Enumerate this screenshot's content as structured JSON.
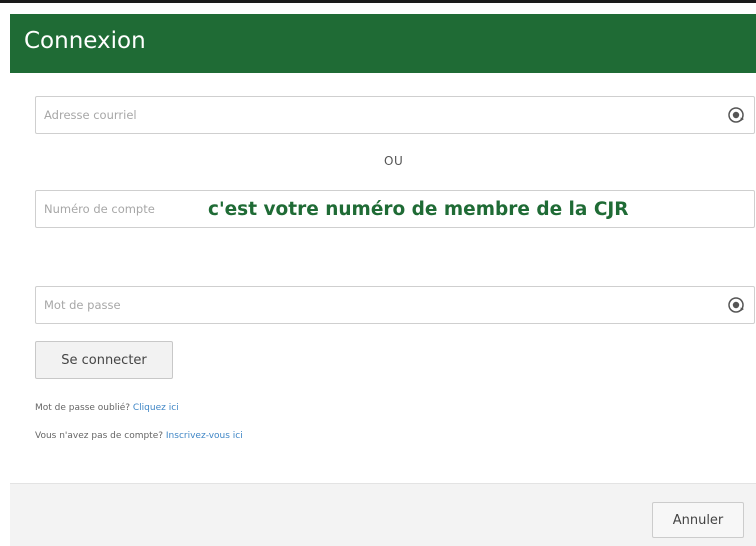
{
  "dialog": {
    "title": "Connexion"
  },
  "form": {
    "email_placeholder": "Adresse courriel",
    "or_text": "OU",
    "account_placeholder": "Numéro de compte",
    "account_hint": "c'est votre numéro de membre de la CJR",
    "password_placeholder": "Mot de passe",
    "submit_label": "Se connecter",
    "forgot_text": "Mot de passe oublié?",
    "forgot_link": "Cliquez ici",
    "no_account_text": "Vous n'avez pas de compte?",
    "register_link": "Inscrivez-vous ici"
  },
  "footer": {
    "cancel_label": "Annuler"
  },
  "icons": {
    "password_manager": "key-fill-icon"
  },
  "colors": {
    "header_bg": "#1f6b35",
    "hint_text": "#1f6b35",
    "link": "#3f86c6"
  }
}
